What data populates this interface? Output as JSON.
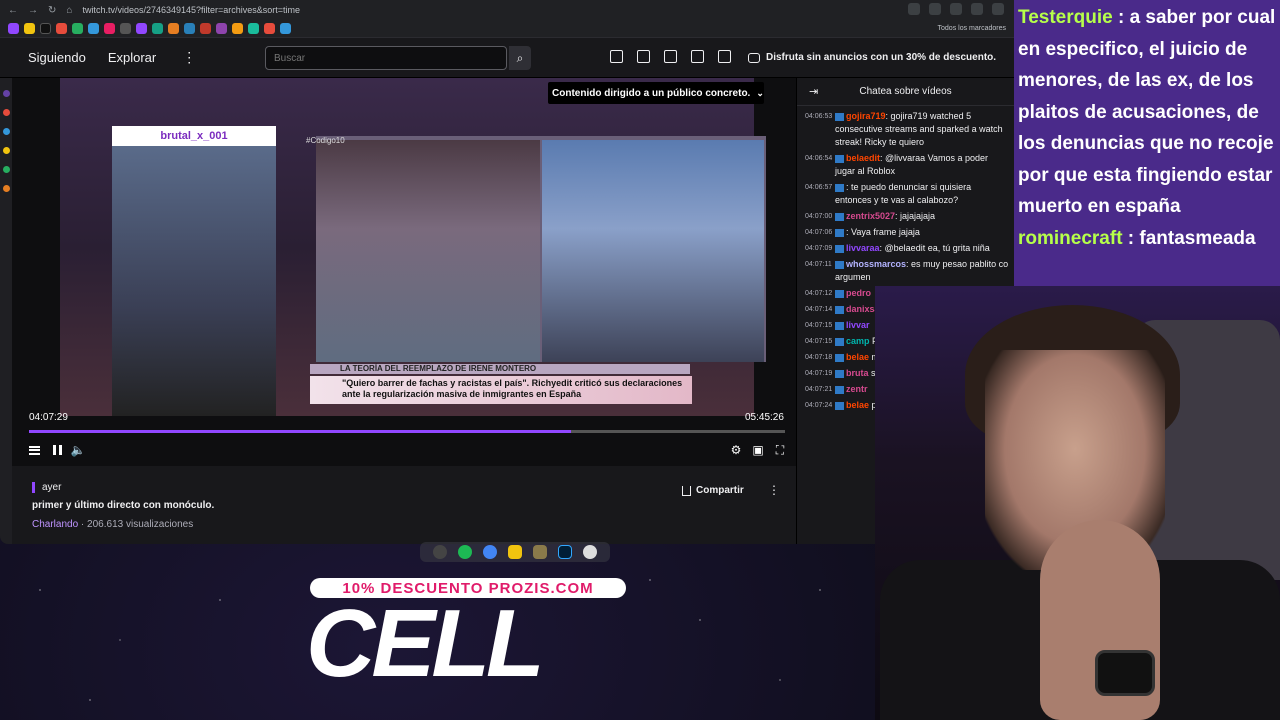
{
  "browser": {
    "url": "twitch.tv/videos/2746349145?filter=archives&sort=time",
    "bookmarks_label": "Todos los marcadores"
  },
  "twitch_nav": {
    "following": "Siguiendo",
    "explore": "Explorar",
    "more": "⋮",
    "search_placeholder": "Buscar",
    "promo": "Disfruta sin anuncios con un 30% de descuento."
  },
  "player": {
    "audience_banner": "Contenido dirigido a un público concreto.",
    "cam_label": "brutal_x_001",
    "show_tag": "#Codigo10",
    "lower_third_title": "LA TEORÍA DEL REEMPLAZO DE IRENE MONTERO",
    "lower_third_quote": "\"Quiero barrer de fachas y racistas el país\". Richyedit criticó sus declaraciones ante la regularización masiva de inmigrantes en España",
    "elapsed": "04:07:29",
    "duration": "05:45:26",
    "progress_fraction": 0.717
  },
  "video_info": {
    "date": "ayer",
    "title": "primer y último directo con monóculo.",
    "category": "Charlando",
    "views": " · 206.613 visualizaciones",
    "share": "Compartir"
  },
  "chat": {
    "header": "Chatea sobre vídeos",
    "messages": [
      {
        "ts": "04:06:53",
        "user": "gojira719",
        "text": ": gojira719 watched 5 consecutive streams and sparked a watch streak! Ricky te quiero",
        "cls": "u2"
      },
      {
        "ts": "04:06:54",
        "user": "belaedit",
        "text": ": @livvaraa Vamos a poder jugar al Roblox",
        "cls": "u2"
      },
      {
        "ts": "04:06:57",
        "user": "",
        "text": ": te puedo denunciar si quisiera entonces y te vas al calabozo?",
        "cls": "u3"
      },
      {
        "ts": "04:07:00",
        "user": "zentrix5027",
        "text": ": jajajajaja",
        "cls": "u1"
      },
      {
        "ts": "04:07:06",
        "user": "",
        "text": ": Vaya frame jajaja",
        "cls": "u3"
      },
      {
        "ts": "04:07:09",
        "user": "livvaraa",
        "text": ": @belaedit ea, tú grita niña",
        "cls": "u3"
      },
      {
        "ts": "04:07:11",
        "user": "whossmarcos",
        "text": ": es muy pesao pablito co argumen",
        "cls": "u4"
      },
      {
        "ts": "04:07:12",
        "user": "pedro",
        "text": "",
        "cls": "u1"
      },
      {
        "ts": "04:07:14",
        "user": "danixsa",
        "text": "",
        "cls": "u1"
      },
      {
        "ts": "04:07:15",
        "user": "livvar",
        "text": "",
        "cls": "u3"
      },
      {
        "ts": "04:07:15",
        "user": "camp",
        "text": " Prime. T months!",
        "cls": "u6"
      },
      {
        "ts": "04:07:18",
        "user": "belae",
        "text": " meten tir",
        "cls": "u2"
      },
      {
        "ts": "04:07:19",
        "user": "bruta",
        "text": " subscrib subscrib",
        "cls": "u1"
      },
      {
        "ts": "04:07:21",
        "user": "zentr",
        "text": "",
        "cls": "u1"
      },
      {
        "ts": "04:07:24",
        "user": "belae",
        "text": " perdono",
        "cls": "u2"
      }
    ]
  },
  "overlay_chat": [
    {
      "name": "Testerquie",
      "text": " : a saber por cual en especifico, el juicio de menores, de las ex, de los plaitos de acusaciones, de los denuncias que no recoje por que esta fingiendo estar muerto en españa"
    },
    {
      "name": "rominecraft",
      "text": " : fantasmeada"
    }
  ],
  "ad": {
    "tagline": "10% DESCUENTO PROZIS.COM",
    "brand": "CELL"
  }
}
